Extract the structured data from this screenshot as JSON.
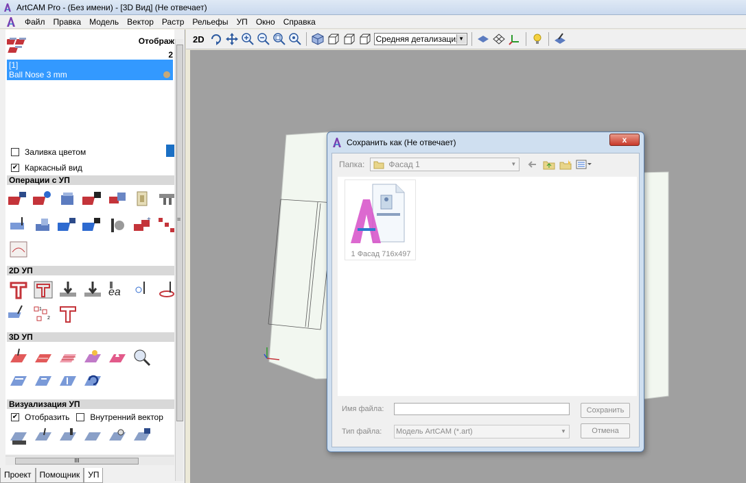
{
  "window": {
    "title": "ArtCAM Pro - (Без имени) - [3D Вид] (Не отвечает)"
  },
  "menu": {
    "items": [
      "Файл",
      "Правка",
      "Модель",
      "Вектор",
      "Растр",
      "Рельефы",
      "УП",
      "Окно",
      "Справка"
    ]
  },
  "left_panel": {
    "toolbox_label": "Отображ",
    "toolbox_count": "2",
    "tool": {
      "index": "[1]",
      "name": "Ball Nose 3 mm"
    },
    "options": {
      "color_fill": "Заливка цветом",
      "color_fill_checked": false,
      "wireframe": "Каркасный вид",
      "wireframe_checked": true
    },
    "sections": {
      "operations": "Операции с УП",
      "toolpaths_2d": "2D УП",
      "toolpaths_3d": "3D УП",
      "visualization": "Визуализация УП"
    },
    "visualization_options": {
      "show": "Отобразить",
      "show_checked": true,
      "inner_vector": "Внутренний вектор",
      "inner_vector_checked": false
    },
    "scrollbar_grip": "III",
    "tabs": [
      "Проект",
      "Помощник",
      "УП"
    ],
    "active_tab": "УП"
  },
  "toolbar": {
    "mode_2d": "2D",
    "detail_level": "Средняя детализация"
  },
  "dialog": {
    "title": "Сохранить как (Не отвечает)",
    "close_label": "x",
    "folder_label": "Папка:",
    "folder_value": "Фасад 1",
    "file": {
      "name": "1 Фасад 716x497"
    },
    "filename_label": "Имя файла:",
    "filename_value": "",
    "filetype_label": "Тип файла:",
    "filetype_value": "Модель ArtCAM (*.art)",
    "save_button": "Сохранить",
    "cancel_button": "Отмена"
  },
  "colors": {
    "selection": "#3399ff",
    "viewport_bg": "#a0a0a0",
    "dialog_frame": "#cfdff0",
    "close_button": "#c8392a"
  }
}
